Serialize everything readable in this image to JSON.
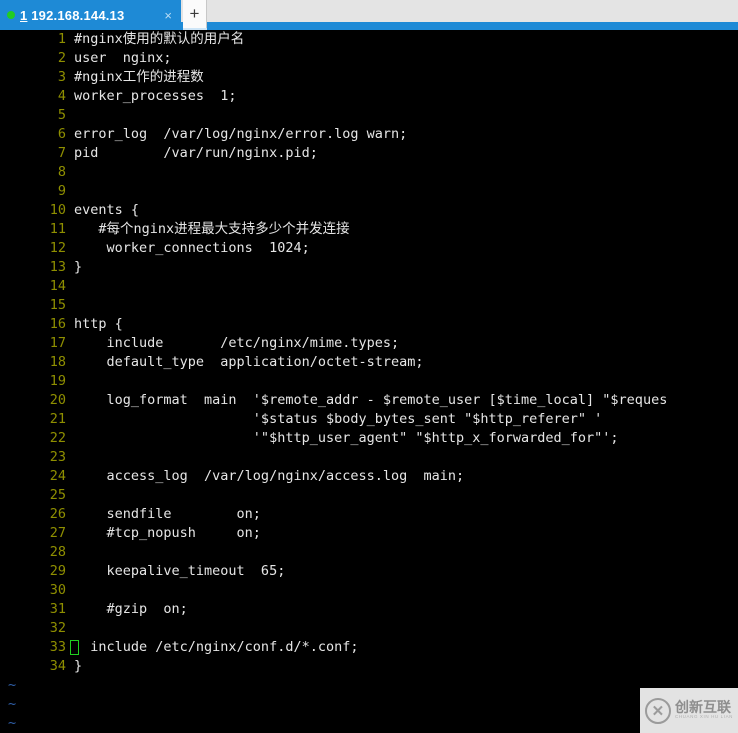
{
  "tabbar": {
    "status_icon": "green-dot",
    "tab_index": "1",
    "tab_host": " 192.168.144.13",
    "close_label": "×",
    "new_tab_label": "+"
  },
  "editor": {
    "filename_implied": "nginx.conf",
    "cursor": {
      "line": 33,
      "column": 1
    },
    "lines": [
      {
        "n": "1",
        "text": "#nginx使用的默认的用户名"
      },
      {
        "n": "2",
        "text": "user  nginx;"
      },
      {
        "n": "3",
        "text": "#nginx工作的进程数"
      },
      {
        "n": "4",
        "text": "worker_processes  1;"
      },
      {
        "n": "5",
        "text": ""
      },
      {
        "n": "6",
        "text": "error_log  /var/log/nginx/error.log warn;"
      },
      {
        "n": "7",
        "text": "pid        /var/run/nginx.pid;"
      },
      {
        "n": "8",
        "text": ""
      },
      {
        "n": "9",
        "text": ""
      },
      {
        "n": "10",
        "text": "events {"
      },
      {
        "n": "11",
        "text": "   #每个nginx进程最大支持多少个并发连接"
      },
      {
        "n": "12",
        "text": "    worker_connections  1024;"
      },
      {
        "n": "13",
        "text": "}"
      },
      {
        "n": "14",
        "text": ""
      },
      {
        "n": "15",
        "text": ""
      },
      {
        "n": "16",
        "text": "http {"
      },
      {
        "n": "17",
        "text": "    include       /etc/nginx/mime.types;"
      },
      {
        "n": "18",
        "text": "    default_type  application/octet-stream;"
      },
      {
        "n": "19",
        "text": ""
      },
      {
        "n": "20",
        "text": "    log_format  main  '$remote_addr - $remote_user [$time_local] \"$reques"
      },
      {
        "n": "21",
        "text": "                      '$status $body_bytes_sent \"$http_referer\" '"
      },
      {
        "n": "22",
        "text": "                      '\"$http_user_agent\" \"$http_x_forwarded_for\"';"
      },
      {
        "n": "23",
        "text": ""
      },
      {
        "n": "24",
        "text": "    access_log  /var/log/nginx/access.log  main;"
      },
      {
        "n": "25",
        "text": ""
      },
      {
        "n": "26",
        "text": "    sendfile        on;"
      },
      {
        "n": "27",
        "text": "    #tcp_nopush     on;"
      },
      {
        "n": "28",
        "text": ""
      },
      {
        "n": "29",
        "text": "    keepalive_timeout  65;"
      },
      {
        "n": "30",
        "text": ""
      },
      {
        "n": "31",
        "text": "    #gzip  on;"
      },
      {
        "n": "32",
        "text": ""
      },
      {
        "n": "33",
        "text": "  include /etc/nginx/conf.d/*.conf;"
      },
      {
        "n": "34",
        "text": "}"
      }
    ],
    "empty_markers": [
      "~",
      "~",
      "~"
    ]
  },
  "watermark": {
    "logo_glyph": "✕",
    "text_cn": "创新互联",
    "text_en": "CHUANG XIN HU LIAN"
  },
  "colors": {
    "tab_active": "#1e8ad6",
    "terminal_bg": "#000000",
    "code_fg": "#e6e6e6",
    "line_number_fg": "#8f8f00",
    "cursor": "#20d020",
    "tilde": "#2f5fa8",
    "status_dot": "#22cc22"
  }
}
